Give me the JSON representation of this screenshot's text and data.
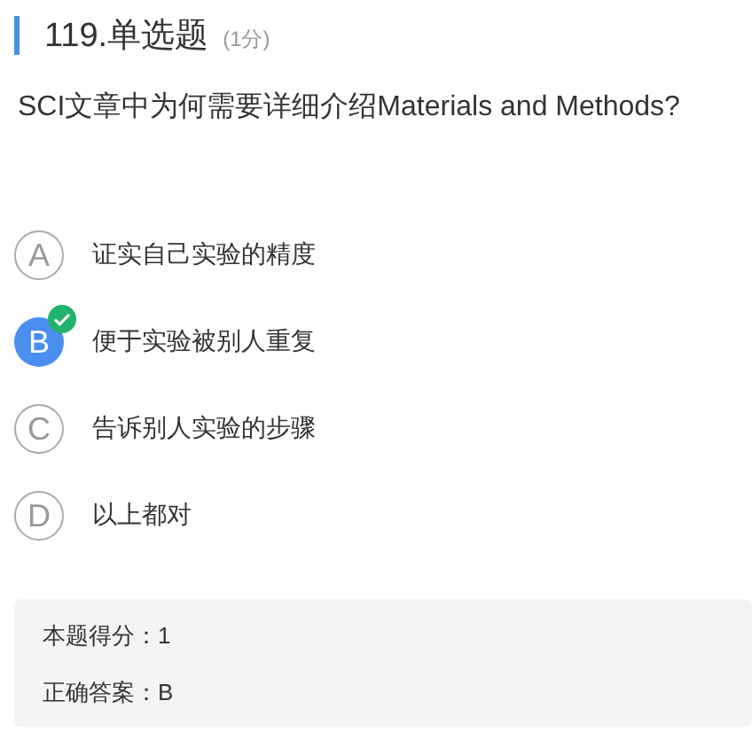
{
  "header": {
    "title": "119.单选题",
    "points": "(1分)"
  },
  "question": "SCI文章中为何需要详细介绍Materials and Methods?",
  "options": [
    {
      "letter": "A",
      "text": "证实自己实验的精度",
      "selected": false,
      "correct": false
    },
    {
      "letter": "B",
      "text": "便于实验被别人重复",
      "selected": true,
      "correct": true
    },
    {
      "letter": "C",
      "text": "告诉别人实验的步骤",
      "selected": false,
      "correct": false
    },
    {
      "letter": "D",
      "text": "以上都对",
      "selected": false,
      "correct": false
    }
  ],
  "summary": [
    {
      "label": "本题得分：",
      "value": "1"
    },
    {
      "label": "正确答案：",
      "value": "B"
    }
  ]
}
